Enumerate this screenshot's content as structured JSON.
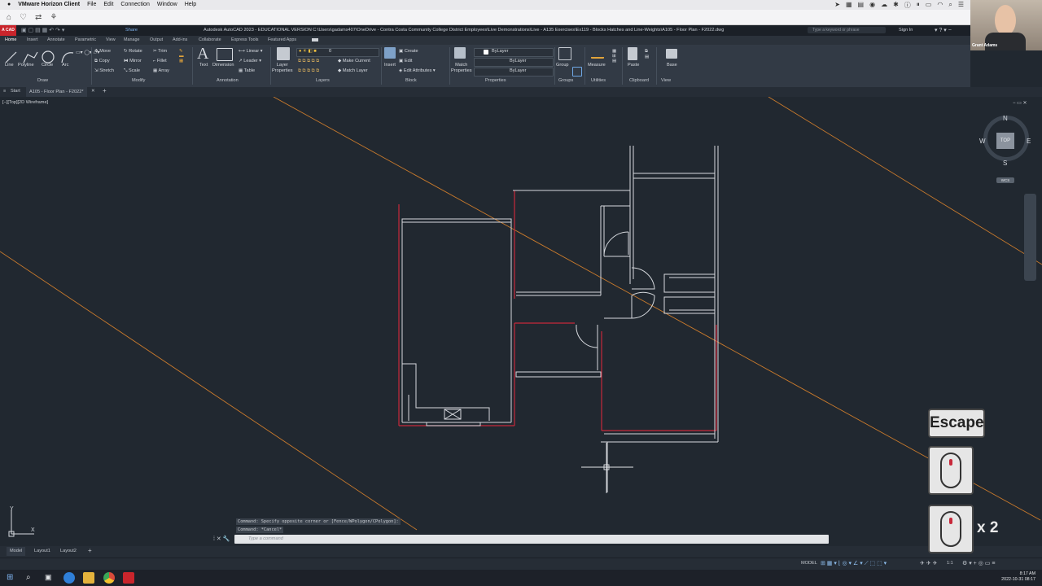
{
  "mac_menu": {
    "apple": "",
    "app": "VMware Horizon Client",
    "items": [
      "File",
      "Edit",
      "Connection",
      "Window",
      "Help"
    ]
  },
  "title_bar": {
    "app_badge": "A CAD",
    "title": "Autodesk AutoCAD 2023 - EDUCATIONAL VERSION    C:\\Users\\gadams407\\OneDrive - Contra Costa Community College District Employees\\Live Demonstrations\\Live - A135 Exercises\\Ex119 - Blocks Hatches and Line-Weights\\A105 - Floor Plan - F2022.dwg",
    "search_placeholder": "Type a keyword or phrase",
    "signin": "Sign In",
    "share": "Share"
  },
  "ribbon_tabs": [
    "Home",
    "Insert",
    "Annotate",
    "Parametric",
    "View",
    "Manage",
    "Output",
    "Add-ins",
    "Collaborate",
    "Express Tools",
    "Featured Apps"
  ],
  "ribbon": {
    "draw": {
      "line": "Line",
      "polyline": "Polyline",
      "circle": "Circle",
      "arc": "Arc",
      "panel": "Draw"
    },
    "modify": {
      "move": "Move",
      "rotate": "Rotate",
      "trim": "Trim",
      "copy": "Copy",
      "mirror": "Mirror",
      "fillet": "Fillet",
      "stretch": "Stretch",
      "scale": "Scale",
      "array": "Array",
      "panel": "Modify"
    },
    "annotation": {
      "text": "Text",
      "dimension": "Dimension",
      "linear": "Linear",
      "leader": "Leader",
      "table": "Table",
      "panel": "Annotation"
    },
    "layers": {
      "layer_properties": "Layer\nProperties",
      "current_layer": "0",
      "make_current": "Make Current",
      "match_layer": "Match Layer",
      "panel": "Layers"
    },
    "block": {
      "insert": "Insert",
      "create": "Create",
      "edit": "Edit",
      "edit_attributes": "Edit Attributes",
      "panel": "Block"
    },
    "properties": {
      "match": "Match\nProperties",
      "color": "ByLayer",
      "linetype": "ByLayer",
      "lineweight": "ByLayer",
      "panel": "Properties"
    },
    "groups": {
      "group": "Group",
      "panel": "Groups"
    },
    "utilities": {
      "measure": "Measure",
      "panel": "Utilities"
    },
    "clipboard": {
      "paste": "Paste",
      "panel": "Clipboard"
    },
    "view": {
      "base": "Base",
      "panel": "View"
    }
  },
  "file_tabs": {
    "start": "Start",
    "current": "A105 - Floor Plan - F2022*"
  },
  "viewport_label": "[−][Top][2D Wireframe]",
  "viewcube": {
    "n": "N",
    "s": "S",
    "e": "E",
    "w": "W",
    "top": "TOP",
    "wcs": "WCS"
  },
  "ucs": {
    "x": "X",
    "y": "Y"
  },
  "command": {
    "line1": "Command: Specify opposite corner or [Fence/WPolygon/CPolygon]:",
    "line2": "Command: *Cancel*",
    "placeholder": "Type a command"
  },
  "layout_tabs": [
    "Model",
    "Layout1",
    "Layout2"
  ],
  "status": {
    "model": "MODEL",
    "scale": "1:1"
  },
  "clock": {
    "time": "8:17 AM",
    "date": "2022-10-31 08:17"
  },
  "webcam_name": "Grant Adams",
  "overlays": {
    "key": "Escape",
    "count": "x 2"
  },
  "colors": {
    "red_lines": "#c8283a",
    "orange_lines": "#c97a2c",
    "walls": "#d6d9de"
  }
}
